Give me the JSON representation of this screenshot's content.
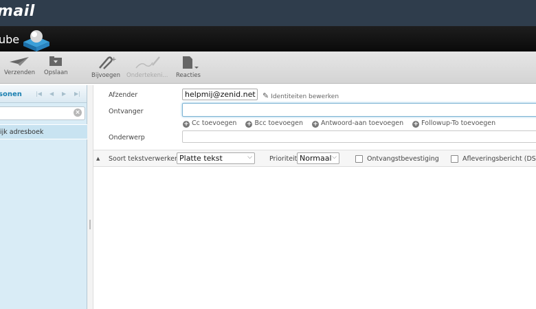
{
  "app": {
    "brand": "mail",
    "logo_text": "ube"
  },
  "toolbar": {
    "send_label": "Verzenden",
    "save_label": "Opslaan",
    "attach_label": "Bijvoegen",
    "sign_label": "Ondertekeni...",
    "responses_label": "Reacties"
  },
  "sidebar": {
    "title": "sonen",
    "search": {
      "value": "",
      "placeholder": ""
    },
    "items": [
      {
        "label": "ijk adresboek"
      }
    ]
  },
  "compose": {
    "from_label": "Afzender",
    "from_value": "helpmij@zenid.net",
    "edit_identities": "Identiteiten bewerken",
    "to_label": "Ontvanger",
    "to_value": "",
    "add_cc": "Cc toevoegen",
    "add_bcc": "Bcc toevoegen",
    "add_reply_to": "Antwoord-aan toevoegen",
    "add_followup_to": "Followup-To toevoegen",
    "subject_label": "Onderwerp",
    "subject_value": ""
  },
  "options": {
    "editor_label": "Soort tekstverwerker",
    "editor_value": "Platte tekst",
    "priority_label": "Prioriteit",
    "priority_value": "Normaal",
    "receipt_label": "Ontvangstbevestiging",
    "receipt_checked": false,
    "dsn_label": "Afleveringsbericht (DSN",
    "dsn_checked": false
  },
  "colors": {
    "topbar": "#2f3d4c",
    "sidebar": "#d9ecf6",
    "accent": "#1a7fb0"
  }
}
